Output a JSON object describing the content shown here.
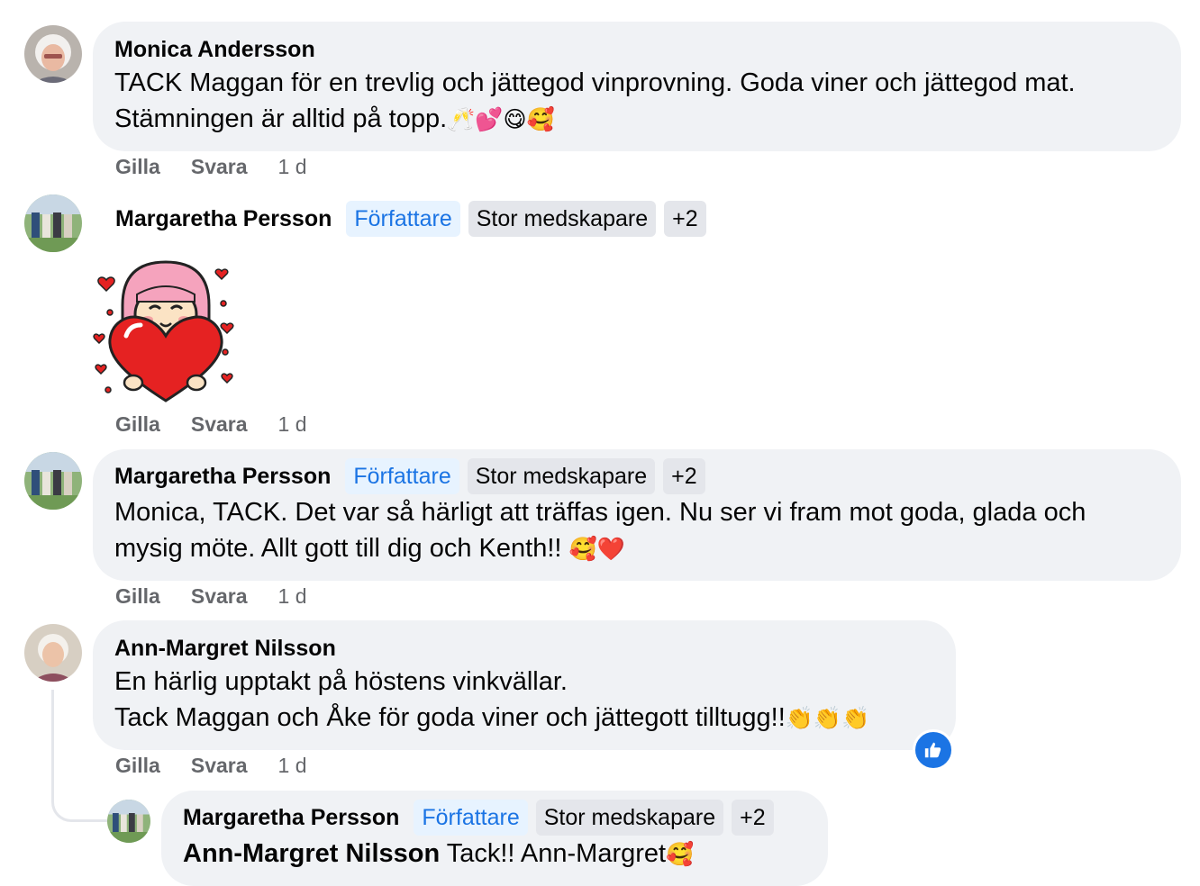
{
  "comments": [
    {
      "author": "Monica Andersson",
      "text_line1": "TACK Maggan för en trevlig och jättegod vinprovning. Goda viner och jättegod mat.",
      "text_line2": "Stämningen är alltid på topp.",
      "emojis": "🥂💕😋🥰",
      "like": "Gilla",
      "reply": "Svara",
      "time": "1 d"
    },
    {
      "author": "Margaretha Persson",
      "badge_author": "Författare",
      "badge_contributor": "Stor medskapare",
      "badge_more": "+2",
      "sticker": "girl-holding-heart-sticker",
      "like": "Gilla",
      "reply": "Svara",
      "time": "1 d"
    },
    {
      "author": "Margaretha Persson",
      "badge_author": "Författare",
      "badge_contributor": "Stor medskapare",
      "badge_more": "+2",
      "text_line1": "Monica, TACK. Det var så härligt att träffas igen. Nu ser vi fram mot goda, glada och",
      "text_line2": "mysig möte. Allt gott till dig och Kenth!! ",
      "emojis": "🥰❤️",
      "like": "Gilla",
      "reply": "Svara",
      "time": "1 d"
    },
    {
      "author": "Ann-Margret Nilsson",
      "text_line1": "En härlig upptakt på höstens vinkvällar.",
      "text_line2": "Tack Maggan och Åke för goda viner och jättegott tilltugg!!",
      "emojis": "👏👏👏",
      "reaction": "like-icon",
      "like": "Gilla",
      "reply": "Svara",
      "time": "1 d"
    }
  ],
  "reply": {
    "author": "Margaretha Persson",
    "badge_author": "Författare",
    "badge_contributor": "Stor medskapare",
    "badge_more": "+2",
    "mention": "Ann-Margret Nilsson",
    "text": " Tack!! Ann-Margret",
    "emojis": "🥰"
  },
  "colors": {
    "bubble": "#f0f2f5",
    "author_badge_bg": "#e7f3ff",
    "author_badge_text": "#1b74e4",
    "badge_bg": "#e4e6eb",
    "meta_text": "#65676b",
    "like_blue": "#1b74e4"
  }
}
